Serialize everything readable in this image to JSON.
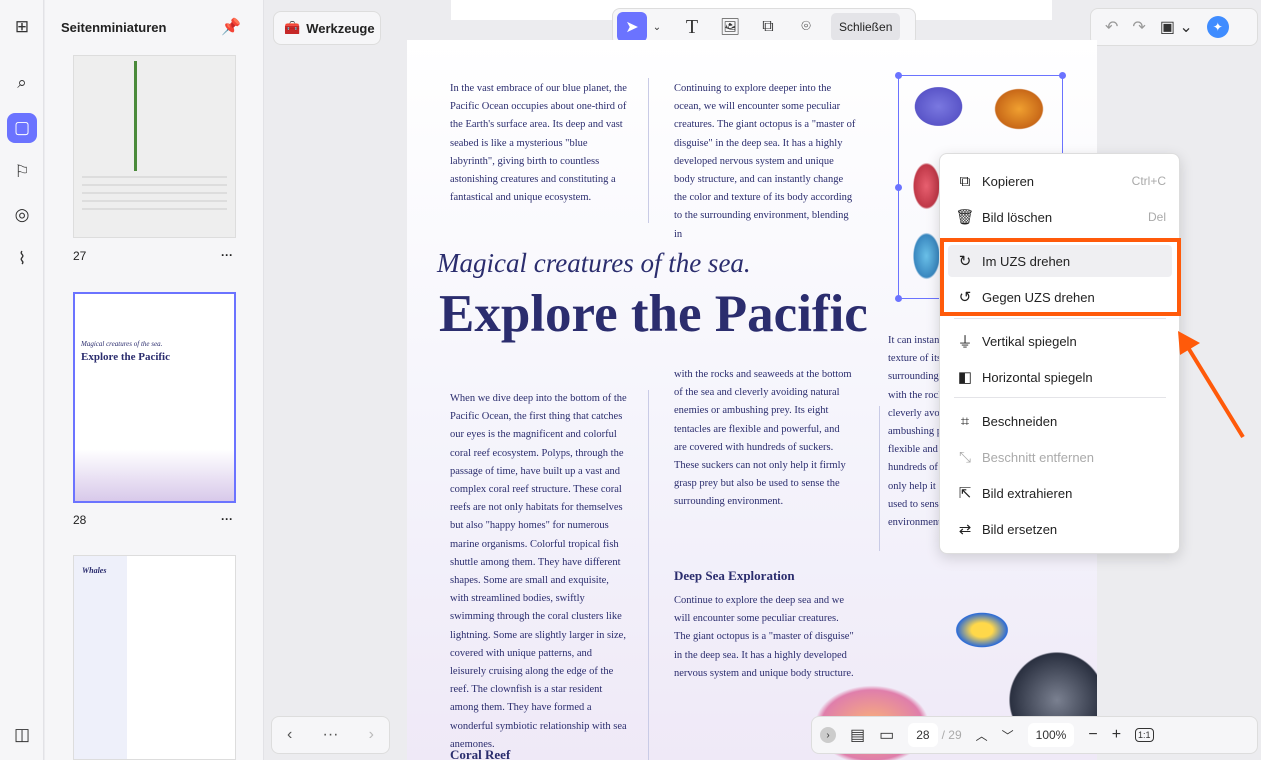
{
  "sidebar": {
    "title": "Seitenminiaturen",
    "pages": [
      {
        "num": "27",
        "more": "···"
      },
      {
        "num": "28",
        "more": "···"
      }
    ],
    "thumb28": {
      "subtitle": "Magical creatures of the sea.",
      "title": "Explore the Pacific"
    },
    "thumb29": {
      "title": "Whales"
    }
  },
  "toolbar": {
    "tools_label": "Werkzeuge",
    "close_label": "Schließen"
  },
  "document": {
    "col1_top": "In the vast embrace of our blue planet, the Pacific Ocean occupies about one-third of the Earth's surface area. Its deep and vast seabed is like a mysterious \"blue labyrinth\", giving birth to countless astonishing creatures and constituting a fantastical and unique ecosystem.",
    "col2_top": "Continuing to explore deeper into the ocean, we will encounter some peculiar creatures. The giant octopus is a \"master of disguise\" in the deep sea. It has a highly developed nervous system and unique body structure, and can instantly change the color and texture of its body according to the surrounding environment, blending in",
    "subtitle": "Magical creatures of the sea.",
    "title": "Explore the Pacific",
    "col1_body": "When we dive deep into the bottom of the Pacific Ocean, the first thing that catches our eyes is the magnificent and colorful coral reef ecosystem. Polyps, through the passage of time, have built up a vast and complex coral reef structure. These coral reefs are not only habitats for themselves but also \"happy homes\" for numerous marine organisms. Colorful tropical fish shuttle among them. They have different shapes. Some are small and exquisite, with streamlined bodies, swiftly swimming through the coral clusters like lightning. Some are slightly larger in size, covered with unique patterns, and leisurely cruising along the edge of the reef. The clownfish is a star resident among them. They have formed a wonderful symbiotic relationship with sea anemones.",
    "col1_heading": "Coral Reef",
    "col2_body": "with the rocks and seaweeds at the bottom of the sea and cleverly avoiding natural enemies or ambushing prey. Its eight tentacles are flexible and powerful, and are covered with hundreds of suckers. These suckers can not only help it firmly grasp prey but also be used to sense the surrounding environment.",
    "col2_heading": "Deep Sea Exploration",
    "col2_body2": "Continue to explore the deep sea and we will encounter some peculiar creatures. The giant octopus is a \"master of disguise\" in the deep sea. It has a highly developed nervous system and unique body structure.",
    "col3_lines": [
      "It can instan",
      "texture of its",
      "surrounding",
      "with the rock",
      "cleverly avo",
      "ambushing p",
      "flexible and",
      "hundreds of",
      "only help it",
      "used to sens",
      "environment"
    ]
  },
  "context_menu": [
    {
      "label": "Kopieren",
      "shortcut": "Ctrl+C",
      "icon": "copy-icon"
    },
    {
      "label": "Bild löschen",
      "shortcut": "Del",
      "icon": "trash-icon"
    },
    {
      "label": "Im UZS drehen",
      "icon": "rotate-clockwise-icon"
    },
    {
      "label": "Gegen UZS drehen",
      "icon": "rotate-counterclockwise-icon"
    },
    {
      "label": "Vertikal spiegeln",
      "icon": "flip-vertical-icon"
    },
    {
      "label": "Horizontal spiegeln",
      "icon": "flip-horizontal-icon"
    },
    {
      "label": "Beschneiden",
      "icon": "crop-icon"
    },
    {
      "label": "Beschnitt entfernen",
      "icon": "remove-crop-icon",
      "disabled": true
    },
    {
      "label": "Bild extrahieren",
      "icon": "extract-image-icon"
    },
    {
      "label": "Bild ersetzen",
      "icon": "replace-image-icon"
    }
  ],
  "bottom_bar": {
    "page_current": "28",
    "page_total": "/ 29",
    "zoom": "100%",
    "fit_label": "1:1",
    "more": "···"
  },
  "colors": {
    "accent": "#6b73ff",
    "highlight": "#ff5a0a",
    "text": "#2b2d6e"
  }
}
